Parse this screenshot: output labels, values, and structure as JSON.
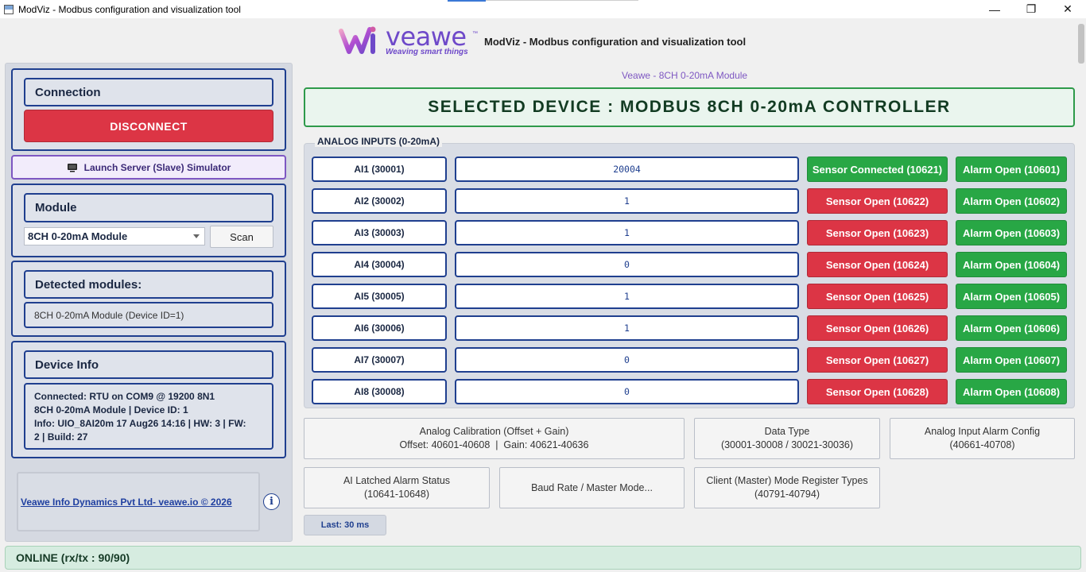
{
  "window": {
    "title": "ModViz - Modbus configuration and visualization tool"
  },
  "header": {
    "brand": "veawe",
    "tagline": "Weaving smart things",
    "trademark": "™",
    "title": "ModViz - Modbus configuration and visualization tool",
    "brand_color": "#6e49c9"
  },
  "sidebar": {
    "connection_label": "Connection",
    "disconnect_label": "DISCONNECT",
    "simulator_label": "Launch Server (Slave) Simulator",
    "module_label": "Module",
    "module_selected": "8CH 0-20mA Module",
    "scan_label": "Scan",
    "detected_label": "Detected modules:",
    "detected_value": "8CH 0-20mA Module (Device ID=1)",
    "device_info_label": "Device Info",
    "device_info_line1": "Connected: RTU on COM9 @ 19200 8N1",
    "device_info_line2": "8CH 0-20mA Module | Device ID: 1",
    "device_info_line3": "Info: UIO_8AI20m 17 Aug26 14:16 | HW: 3 | FW:",
    "device_info_line4": "2 | Build: 27",
    "footer_link": "Veawe Info Dynamics Pvt Ltd- veawe.io © 2026",
    "info_icon": "i"
  },
  "main": {
    "module_caption": "Veawe - 8CH 0-20mA Module",
    "selected_device": "SELECTED DEVICE : MODBUS 8CH 0-20mA CONTROLLER",
    "analog_group_label": "ANALOG INPUTS (0-20mA)",
    "inputs": [
      {
        "label": "AI1 (30001)",
        "value": "20004",
        "sensor": "Sensor Connected (10621)",
        "sensor_status": "ok",
        "alarm": "Alarm Open (10601)"
      },
      {
        "label": "AI2 (30002)",
        "value": "1",
        "sensor": "Sensor Open (10622)",
        "sensor_status": "open",
        "alarm": "Alarm Open (10602)"
      },
      {
        "label": "AI3 (30003)",
        "value": "1",
        "sensor": "Sensor Open (10623)",
        "sensor_status": "open",
        "alarm": "Alarm Open (10603)"
      },
      {
        "label": "AI4 (30004)",
        "value": "0",
        "sensor": "Sensor Open (10624)",
        "sensor_status": "open",
        "alarm": "Alarm Open (10604)"
      },
      {
        "label": "AI5 (30005)",
        "value": "1",
        "sensor": "Sensor Open (10625)",
        "sensor_status": "open",
        "alarm": "Alarm Open (10605)"
      },
      {
        "label": "AI6 (30006)",
        "value": "1",
        "sensor": "Sensor Open (10626)",
        "sensor_status": "open",
        "alarm": "Alarm Open (10606)"
      },
      {
        "label": "AI7 (30007)",
        "value": "0",
        "sensor": "Sensor Open (10627)",
        "sensor_status": "open",
        "alarm": "Alarm Open (10607)"
      },
      {
        "label": "AI8 (30008)",
        "value": "0",
        "sensor": "Sensor Open (10628)",
        "sensor_status": "open",
        "alarm": "Alarm Open (10608)"
      }
    ],
    "buttons": {
      "calibration_line1": "Analog Calibration (Offset + Gain)",
      "calibration_line2": "Offset: 40601-40608  |  Gain: 40621-40636",
      "datatype_line1": "Data Type",
      "datatype_line2": "(30001-30008 / 30021-30036)",
      "alarm_config_line1": "Analog Input Alarm Config",
      "alarm_config_line2": "(40661-40708)",
      "latched_line1": "AI Latched Alarm Status",
      "latched_line2": "(10641-10648)",
      "baud_label": "Baud Rate / Master Mode...",
      "client_line1": "Client (Master) Mode Register Types",
      "client_line2": "(40791-40794)"
    },
    "last_label": "Last: 30 ms"
  },
  "status": {
    "text": "ONLINE (rx/tx : 90/90)"
  },
  "colors": {
    "accent_blue": "#1f3f8f",
    "danger": "#dc3545",
    "success": "#28a745",
    "purple": "#7e57c2"
  }
}
